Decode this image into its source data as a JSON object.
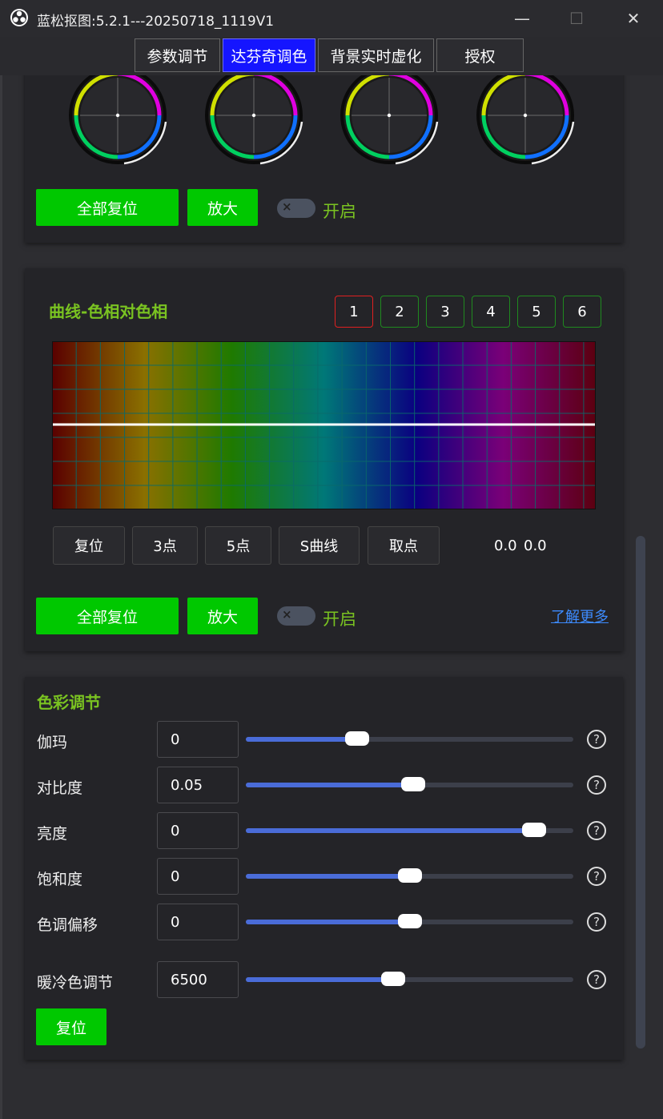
{
  "window": {
    "title": "蓝松抠图:5.2.1---20250718_1119V1",
    "minimize": "—",
    "maximize": "☐",
    "close": "✕"
  },
  "tabs": [
    {
      "label": "参数调节"
    },
    {
      "label": "达芬奇调色",
      "active": true
    },
    {
      "label": "背景实时虚化"
    },
    {
      "label": "授权"
    }
  ],
  "wheels_panel": {
    "reset_all": "全部复位",
    "zoom": "放大",
    "toggle_state": "off",
    "toggle_icon": "×",
    "toggle_label": "开启"
  },
  "curve_panel": {
    "title": "曲线-色相对色相",
    "tabs": [
      "1",
      "2",
      "3",
      "4",
      "5",
      "6"
    ],
    "selected_tab": "1",
    "tools": [
      "复位",
      "3点",
      "5点",
      "S曲线",
      "取点"
    ],
    "readout_x": "0.0",
    "readout_y": "0.0",
    "reset_all": "全部复位",
    "zoom": "放大",
    "toggle_state": "off",
    "toggle_icon": "×",
    "toggle_label": "开启",
    "learn_more": "了解更多"
  },
  "color_panel": {
    "title": "色彩调节",
    "rows": [
      {
        "label": "伽玛",
        "value": "0",
        "level": 0.34
      },
      {
        "label": "对比度",
        "value": "0.05",
        "level": 0.51
      },
      {
        "label": "亮度",
        "value": "0",
        "level": 0.88
      },
      {
        "label": "饱和度",
        "value": "0",
        "level": 0.5
      },
      {
        "label": "色调偏移",
        "value": "0",
        "level": 0.5
      },
      {
        "label": "暖冷色调节",
        "value": "6500",
        "level": 0.45
      }
    ],
    "help_icon": "?",
    "reset": "复位"
  },
  "colors": {
    "accent_green": "#00c800",
    "title_green": "#7ac321",
    "active_tab": "#1515ff",
    "slider_fill": "#4a6cd8",
    "link": "#3d8bff"
  }
}
